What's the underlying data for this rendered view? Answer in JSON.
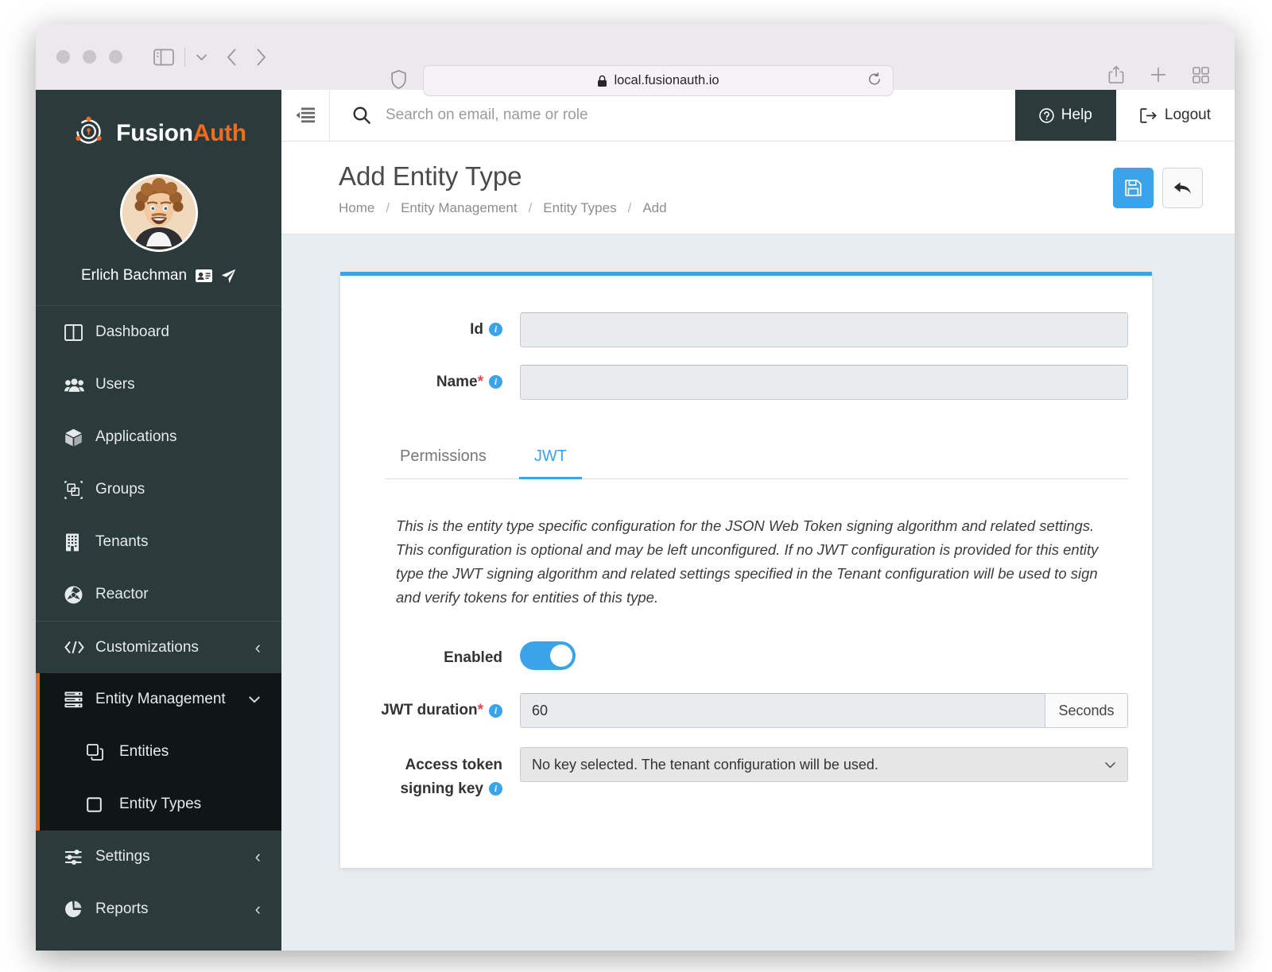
{
  "browser": {
    "url": "local.fusionauth.io",
    "lock_icon": "lock-icon",
    "reload_icon": "reload-icon",
    "shield_icon": "shield-icon",
    "share_icon": "share-icon",
    "new_tab_icon": "plus-icon",
    "tab_overview_icon": "grid-icon",
    "back_icon": "chevron-left-icon",
    "forward_icon": "chevron-right-icon",
    "sidebar_icon": "sidebar-panel-icon",
    "sidebar_dropdown_icon": "chevron-down-icon"
  },
  "sidebar": {
    "brand": {
      "first": "Fusion",
      "second": "Auth"
    },
    "user": {
      "name": "Erlich Bachman",
      "card_icon": "id-card-icon",
      "impersonate_icon": "paper-plane-icon"
    },
    "items": [
      {
        "label": "Dashboard",
        "icon": "dashboard-icon",
        "chevron": ""
      },
      {
        "label": "Users",
        "icon": "users-icon",
        "chevron": ""
      },
      {
        "label": "Applications",
        "icon": "applications-box-icon",
        "chevron": ""
      },
      {
        "label": "Groups",
        "icon": "groups-icon",
        "chevron": ""
      },
      {
        "label": "Tenants",
        "icon": "tenants-building-icon",
        "chevron": ""
      },
      {
        "label": "Reactor",
        "icon": "reactor-icon",
        "chevron": ""
      },
      {
        "label": "Customizations",
        "icon": "code-brackets-icon",
        "chevron": "‹"
      }
    ],
    "active_group": {
      "label": "Entity Management",
      "icon": "server-stack-icon",
      "chevron": "⌄",
      "children": [
        {
          "label": "Entities",
          "icon": "copy-squares-icon"
        },
        {
          "label": "Entity Types",
          "icon": "square-outline-icon"
        }
      ]
    },
    "items_after": [
      {
        "label": "Settings",
        "icon": "sliders-icon",
        "chevron": "‹"
      },
      {
        "label": "Reports",
        "icon": "pie-chart-icon",
        "chevron": "‹"
      }
    ]
  },
  "topbar": {
    "collapse_icon": "collapse-sidebar-icon",
    "search_icon": "search-icon",
    "search_placeholder": "Search on email, name or role",
    "search_value": "",
    "help_label": "Help",
    "help_icon": "question-circle-icon",
    "logout_label": "Logout",
    "logout_icon": "logout-icon"
  },
  "page": {
    "title": "Add Entity Type",
    "breadcrumb": [
      "Home",
      "Entity Management",
      "Entity Types",
      "Add"
    ],
    "breadcrumb_separator": "/",
    "save_icon": "floppy-disk-save-icon",
    "back_icon": "arrow-back-icon"
  },
  "form": {
    "id": {
      "label": "Id",
      "value": "",
      "info_icon": "info-icon"
    },
    "name": {
      "label": "Name",
      "required_marker": "*",
      "value": "",
      "info_icon": "info-icon"
    }
  },
  "tabs": [
    {
      "label": "Permissions",
      "active": false
    },
    {
      "label": "JWT",
      "active": true
    }
  ],
  "jwt": {
    "description": "This is the entity type specific configuration for the JSON Web Token signing algorithm and related settings. This configuration is optional and may be left unconfigured. If no JWT configuration is provided for this entity type the JWT signing algorithm and related settings specified in the Tenant configuration will be used to sign and verify tokens for entities of this type.",
    "enabled": {
      "label": "Enabled",
      "value": "on"
    },
    "duration": {
      "label": "JWT duration",
      "required_marker": "*",
      "value": "60",
      "unit": "Seconds",
      "info_icon": "info-icon"
    },
    "signing_key": {
      "label_line1": "Access token",
      "label_line2": "signing key",
      "value": "No key selected. The tenant configuration will be used.",
      "info_icon": "info-icon",
      "chevron_icon": "chevron-down-icon"
    }
  },
  "colors": {
    "accent_blue": "#3ba3e8",
    "brand_orange": "#f26b21",
    "sidebar_dark": "#2b3a3a",
    "sidebar_active": "#101615",
    "content_bg": "#e8edf1",
    "required_red": "#e2474a"
  }
}
